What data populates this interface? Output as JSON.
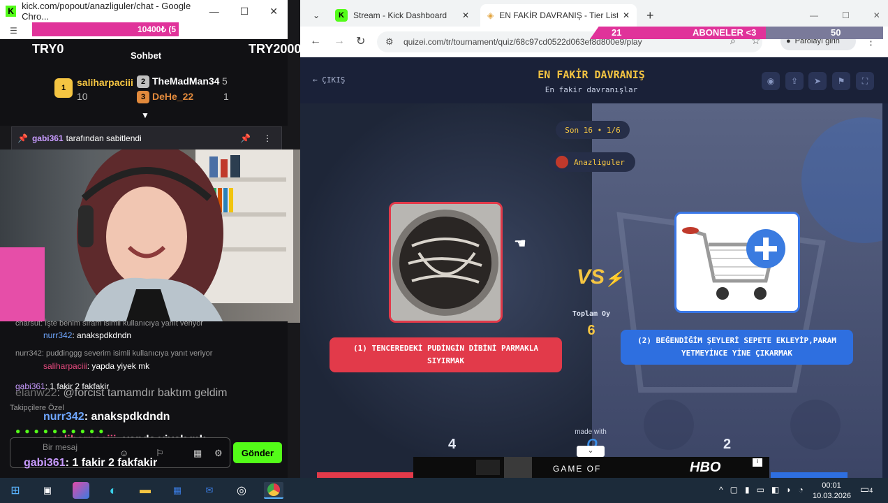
{
  "left_window": {
    "title": "kick.com/popout/anazliguler/chat - Google Chro...",
    "progress_text": "10400₺ (5",
    "try_left": "TRY0",
    "try_right": "TRY2000",
    "chat_header": "Sohbet",
    "leaderboard": [
      {
        "rank": "1",
        "name": "saliharpaciii",
        "count": "10",
        "color": "#f5c542"
      },
      {
        "rank": "2",
        "name": "TheMadMan34",
        "count": "5",
        "color": "#c0c0c0"
      },
      {
        "rank": "3",
        "name": "DeHe_22",
        "count": "1",
        "color": "#e28a3c"
      }
    ],
    "pinned": {
      "user": "gabi361",
      "text": "tarafından sabitlendi"
    },
    "chat": [
      {
        "text": "charsut: İşte benim sıram isimli kullanıcıya yanıt veriyor"
      },
      {
        "user": "nurr342",
        "text": ": anakspdkdndn"
      },
      {
        "text": "nurr342: puddinggg severim isimli kullanıcıya yanıt veriyor"
      },
      {
        "user": "saliharpaciii",
        "text": ": yapda yiyek mk"
      },
      {
        "user": "gabi361",
        "text": ": 1 fakir 2 fakfakir"
      },
      {
        "user": "elanw22",
        "text": ": @forcist tamamdır baktım geldim"
      },
      {
        "user": "nurr342",
        "text": ": anakspdkdndn"
      },
      {
        "user": "saliharpaciii",
        "text": ": yapda yiyek mk"
      },
      {
        "user": "gabi361",
        "text": ": 1 fakir 2 fakfakir"
      }
    ],
    "followers_only": "Takipçilere Özel",
    "input_placeholder": "Bir mesaj",
    "send_label": "Gönder"
  },
  "browser": {
    "tabs": [
      {
        "label": "Stream - Kick Dashboard"
      },
      {
        "label": "EN FAKİR DAVRANIŞ - Tier List"
      }
    ],
    "url": "quizei.com/tr/tournament/quiz/68c97cd0522d063ef8d800e9/play",
    "password_label": "Parolayı girin",
    "sub_overlay": {
      "left": "21",
      "middle": "ABONELER <3",
      "right": "50"
    }
  },
  "quiz": {
    "exit_label": "ÇIKIŞ",
    "title": "EN FAKİR DAVRANIŞ",
    "subtitle": "En fakir davranışlar",
    "round": "Son 16 • 1/6",
    "creator": "Anazliguler",
    "vs": "VS",
    "total_label": "Toplam Oy",
    "total_votes": "6",
    "option1": {
      "label": "(1) TENCEREDEKİ PUDİNGİN DİBİNİ PARMAKLA SIYIRMAK",
      "votes": "4"
    },
    "option2": {
      "label": "(2) BEĞENDİĞİM ŞEYLERİ SEPETE EKLEYİP,PARAM YETMEYİNCE YİNE ÇIKARMAK",
      "votes": "2"
    },
    "made_with": "made with"
  },
  "ad": {
    "brand": "HBO",
    "text": "GAME OF"
  },
  "taskbar": {
    "time": "00:01",
    "date": "10.03.2026",
    "notifications": "4"
  }
}
